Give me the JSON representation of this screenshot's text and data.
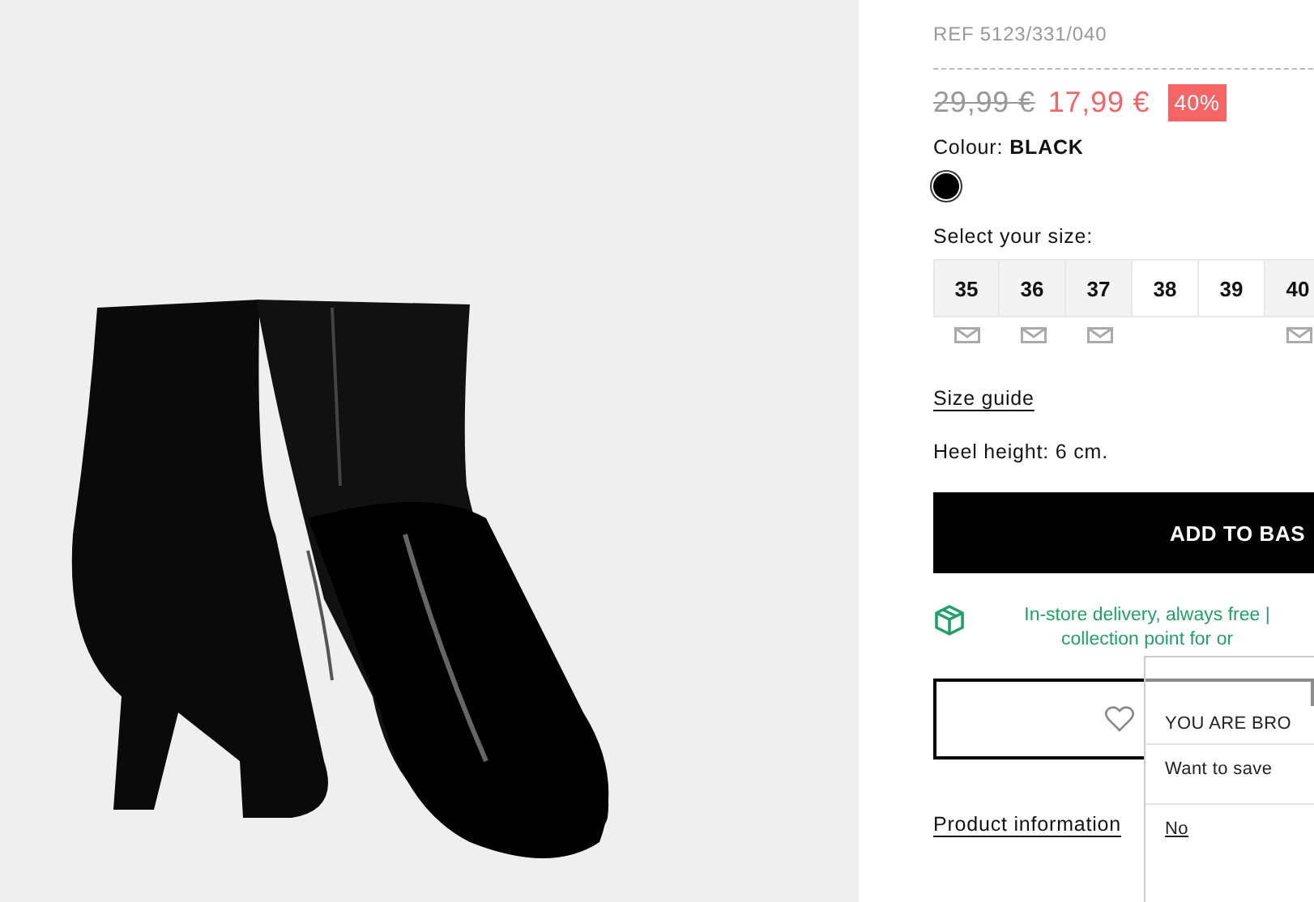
{
  "product": {
    "reference": "REF 5123/331/040",
    "old_price": "29,99 €",
    "price": "17,99 €",
    "discount": "40%",
    "colour_label": "Colour:",
    "colour_name": "BLACK",
    "swatches": [
      {
        "color": "#000000",
        "selected": true
      }
    ],
    "size_prompt": "Select your size:",
    "sizes": [
      {
        "label": "35",
        "available": false
      },
      {
        "label": "36",
        "available": false
      },
      {
        "label": "37",
        "available": false
      },
      {
        "label": "38",
        "available": true
      },
      {
        "label": "39",
        "available": true
      },
      {
        "label": "40",
        "available": false
      }
    ],
    "size_guide": "Size guide",
    "heel_height": "Heel height: 6 cm.",
    "add_button": "ADD TO BAS",
    "delivery": "In-store delivery, always free | collection point for or",
    "product_information": "Product information"
  },
  "popup": {
    "title": "YOU ARE BRO",
    "message": "Want to save",
    "decline": "No"
  }
}
